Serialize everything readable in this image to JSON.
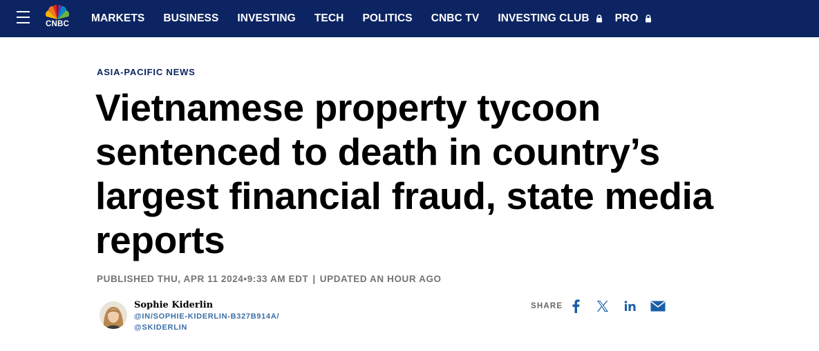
{
  "header": {
    "logo_text": "CNBC",
    "nav": [
      {
        "label": "MARKETS"
      },
      {
        "label": "BUSINESS"
      },
      {
        "label": "INVESTING"
      },
      {
        "label": "TECH"
      },
      {
        "label": "POLITICS"
      },
      {
        "label": "CNBC TV"
      },
      {
        "label": "INVESTING CLUB",
        "locked": true
      },
      {
        "label": "PRO",
        "locked": true
      }
    ],
    "colors": {
      "background": "#0c2462",
      "text": "#ffffff"
    }
  },
  "article": {
    "section": "ASIA-PACIFIC NEWS",
    "headline_lines": [
      "Vietnamese property tycoon",
      "sentenced to death in country’s",
      "largest financial fraud, state media",
      "reports"
    ],
    "published": "PUBLISHED THU, APR 11 2024•9:33 AM EDT",
    "separator": "|",
    "updated": "UPDATED AN HOUR AGO"
  },
  "author": {
    "name": "Sophie Kiderlin",
    "linkedin": "@IN/SOPHIE-KIDERLIN-B327B914A/",
    "twitter": "@SKIDERLIN"
  },
  "share": {
    "label": "SHARE",
    "icons": [
      "facebook-icon",
      "x-twitter-icon",
      "linkedin-icon",
      "email-icon"
    ],
    "icon_color": "#1a5fa8"
  }
}
